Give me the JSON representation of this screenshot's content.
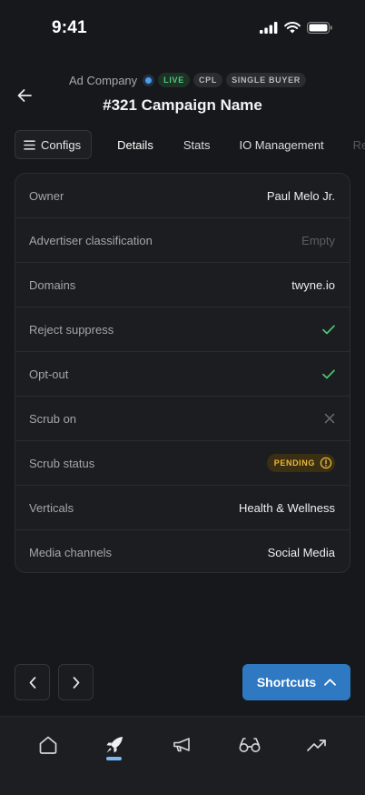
{
  "status_bar": {
    "time": "9:41"
  },
  "header": {
    "company": "Ad Company",
    "badges": [
      "LIVE",
      "CPL",
      "SINGLE BUYER"
    ],
    "title": "#321 Campaign Name"
  },
  "tabs": {
    "configs_label": "Configs",
    "items": [
      "Details",
      "Stats",
      "IO Management",
      "Re"
    ],
    "active": "Details"
  },
  "details": [
    {
      "label": "Owner",
      "value": "Paul Melo Jr."
    },
    {
      "label": "Advertiser classification",
      "value": "Empty"
    },
    {
      "label": "Domains",
      "value": "twyne.io"
    },
    {
      "label": "Reject suppress",
      "icon": "check-icon"
    },
    {
      "label": "Opt-out",
      "icon": "check-icon"
    },
    {
      "label": "Scrub on",
      "icon": "x-icon"
    },
    {
      "label": "Scrub status",
      "status": "PENDING"
    },
    {
      "label": "Verticals",
      "value": "Health & Wellness"
    },
    {
      "label": "Media channels",
      "value": "Social Media"
    }
  ],
  "footer": {
    "shortcuts_label": "Shortcuts"
  },
  "tab_bar": {
    "items": [
      "home-icon",
      "rocket-icon",
      "megaphone-icon",
      "glasses-icon",
      "trending-icon"
    ],
    "active": "rocket-icon"
  },
  "colors": {
    "accent": "#2f79c2",
    "success": "#4ec77a",
    "warning": "#e9b83b",
    "background": "#17181b"
  }
}
